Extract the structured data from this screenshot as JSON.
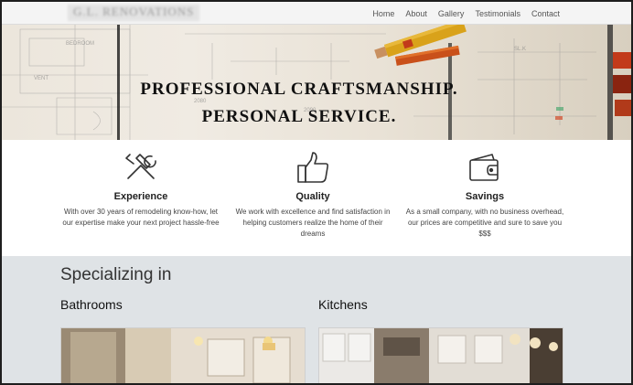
{
  "brand": "G.L. RENOVATIONS",
  "nav": [
    "Home",
    "About",
    "Gallery",
    "Testimonials",
    "Contact"
  ],
  "hero": {
    "line1": "PROFESSIONAL CRAFTSMANSHIP.",
    "line2": "PERSONAL SERVICE."
  },
  "features": [
    {
      "icon": "tools-icon",
      "title": "Experience",
      "text": "With over 30 years of remodeling know-how, let our expertise make your next project hassle-free"
    },
    {
      "icon": "thumbs-up-icon",
      "title": "Quality",
      "text": "We work with excellence and find satisfaction in helping customers realize the home of their dreams"
    },
    {
      "icon": "wallet-icon",
      "title": "Savings",
      "text": "As a small company, with no business overhead, our prices are competitive and sure to save you $$$"
    }
  ],
  "specializing": {
    "heading": "Specializing in",
    "items": [
      "Bathrooms",
      "Kitchens"
    ]
  }
}
